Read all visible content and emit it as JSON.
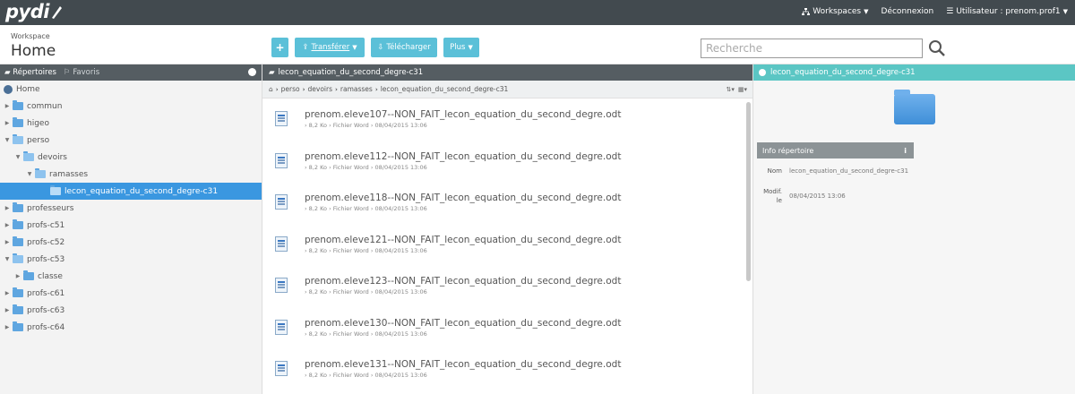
{
  "topbar": {
    "logo": "pydi",
    "workspaces": "Workspaces",
    "logout": "Déconnexion",
    "user": "Utilisateur : prenom.prof1"
  },
  "header": {
    "workspace_label": "Workspace",
    "workspace_title": "Home",
    "buttons": {
      "add": "+",
      "upload": "Transférer",
      "download": "Télécharger",
      "more": "Plus"
    },
    "search_placeholder": "Recherche"
  },
  "left_panel": {
    "tab_folders": "Répertoires",
    "tab_favorites": "Favoris",
    "tree": [
      {
        "label": "Home"
      },
      {
        "label": "commun"
      },
      {
        "label": "higeo"
      },
      {
        "label": "perso"
      },
      {
        "label": "devoirs"
      },
      {
        "label": "ramasses"
      },
      {
        "label": "lecon_equation_du_second_degre-c31"
      },
      {
        "label": "professeurs"
      },
      {
        "label": "profs-c51"
      },
      {
        "label": "profs-c52"
      },
      {
        "label": "profs-c53"
      },
      {
        "label": "classe"
      },
      {
        "label": "profs-c61"
      },
      {
        "label": "profs-c63"
      },
      {
        "label": "profs-c64"
      }
    ]
  },
  "center_panel": {
    "title": "lecon_equation_du_second_degre-c31",
    "breadcrumb": [
      "perso",
      "devoirs",
      "ramasses",
      "lecon_equation_du_second_degre-c31"
    ],
    "files": [
      {
        "name": "prenom.eleve107--NON_FAIT_lecon_equation_du_second_degre.odt",
        "size": "8,2 Ko",
        "type": "Fichier Word",
        "date": "08/04/2015 13:06"
      },
      {
        "name": "prenom.eleve112--NON_FAIT_lecon_equation_du_second_degre.odt",
        "size": "8,2 Ko",
        "type": "Fichier Word",
        "date": "08/04/2015 13:06"
      },
      {
        "name": "prenom.eleve118--NON_FAIT_lecon_equation_du_second_degre.odt",
        "size": "8,2 Ko",
        "type": "Fichier Word",
        "date": "08/04/2015 13:06"
      },
      {
        "name": "prenom.eleve121--NON_FAIT_lecon_equation_du_second_degre.odt",
        "size": "8,2 Ko",
        "type": "Fichier Word",
        "date": "08/04/2015 13:06"
      },
      {
        "name": "prenom.eleve123--NON_FAIT_lecon_equation_du_second_degre.odt",
        "size": "8,2 Ko",
        "type": "Fichier Word",
        "date": "08/04/2015 13:06"
      },
      {
        "name": "prenom.eleve130--NON_FAIT_lecon_equation_du_second_degre.odt",
        "size": "8,2 Ko",
        "type": "Fichier Word",
        "date": "08/04/2015 13:06"
      },
      {
        "name": "prenom.eleve131--NON_FAIT_lecon_equation_du_second_degre.odt",
        "size": "8,2 Ko",
        "type": "Fichier Word",
        "date": "08/04/2015 13:06"
      }
    ]
  },
  "right_panel": {
    "title": "lecon_equation_du_second_degre-c31",
    "info_title": "Info répertoire",
    "name_label": "Nom",
    "name_value": "lecon_equation_du_second_degre-c31",
    "modified_label": "Modif. le",
    "modified_value": "08/04/2015 13:06"
  },
  "colors": {
    "topbar": "#424a4f",
    "accent_button": "#5bc0d8",
    "selection": "#3a97e0",
    "right_header": "#5bc6c4"
  }
}
